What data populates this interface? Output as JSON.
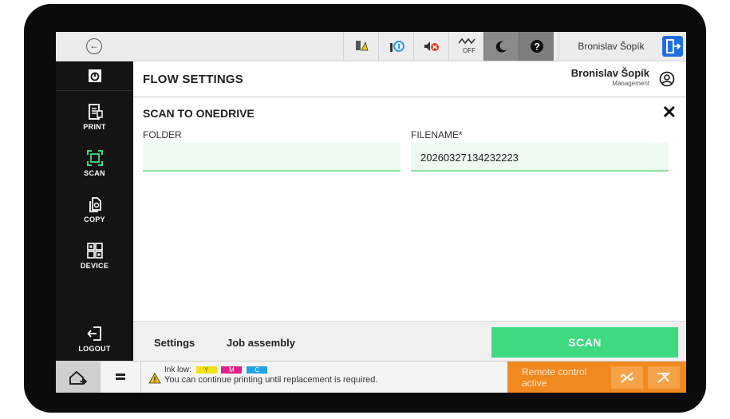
{
  "colors": {
    "accent_green": "#3ed981",
    "remote_orange": "#f08a20",
    "logout_blue": "#1f6fe0"
  },
  "topbar": {
    "back_icon": "back-arrow-icon",
    "status_icons": [
      "toner-warning-icon",
      "ink-info-icon",
      "sound-off-icon",
      "network-off-icon",
      "sleep-moon-icon",
      "help-icon"
    ],
    "network_label": "OFF",
    "user": "Bronislav Šopík",
    "logout_icon": "logout-icon"
  },
  "sidebar": {
    "home_icon": "home-screen-icon",
    "items": [
      {
        "label": "PRINT",
        "icon": "print-icon"
      },
      {
        "label": "SCAN",
        "icon": "scan-icon"
      },
      {
        "label": "COPY",
        "icon": "copy-icon"
      },
      {
        "label": "DEVICE",
        "icon": "device-icon"
      }
    ],
    "logout_label": "LOGOUT"
  },
  "header": {
    "title": "FLOW SETTINGS",
    "user_name": "Bronislav Šopík",
    "user_role": "Management"
  },
  "flow": {
    "title": "SCAN TO ONEDRIVE",
    "folder_label": "FOLDER",
    "folder_value": "",
    "filename_label": "FILENAME*",
    "filename_value": "20260327134232223"
  },
  "actions": {
    "settings": "Settings",
    "job_assembly": "Job assembly",
    "scan": "SCAN"
  },
  "bottombar": {
    "ink_low": "Ink low:",
    "ink_chips": [
      "Y",
      "M",
      "C"
    ],
    "ink_message": "You can continue printing until replacement is required.",
    "remote_text": "Remote control active"
  }
}
